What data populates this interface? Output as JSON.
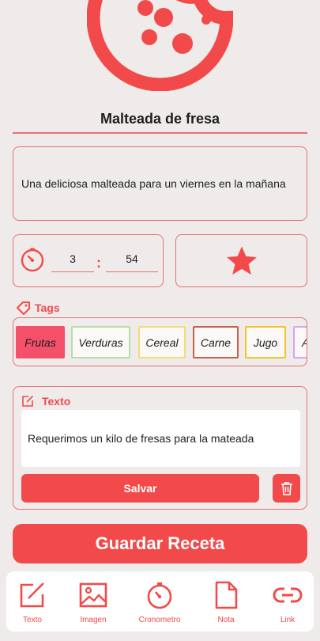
{
  "recipe": {
    "title": "Malteada de fresa",
    "description": "Una deliciosa malteada para un viernes en la mañana"
  },
  "timer": {
    "hours": "3",
    "separator": ":",
    "minutes": "54"
  },
  "favorite": {
    "icon": "star-icon"
  },
  "tags": {
    "label": "Tags",
    "items": [
      {
        "label": "Frutas",
        "selected": true,
        "color": "#f45069"
      },
      {
        "label": "Verduras",
        "selected": false,
        "color": "#b4dfa6"
      },
      {
        "label": "Cereal",
        "selected": false,
        "color": "#f3dc74"
      },
      {
        "label": "Carne",
        "selected": false,
        "color": "#c85e4d"
      },
      {
        "label": "Jugo",
        "selected": false,
        "color": "#f3c42d"
      },
      {
        "label": "A",
        "selected": false,
        "color": "#d6a5ee"
      }
    ]
  },
  "note": {
    "header": "Texto",
    "content": "Requerimos un kilo de fresas para la mateada",
    "save_label": "Salvar"
  },
  "save_recipe_label": "Guardar Receta",
  "bottom_nav": [
    {
      "label": "Texto",
      "icon": "edit-icon"
    },
    {
      "label": "Imagen",
      "icon": "image-icon"
    },
    {
      "label": "Cronometro",
      "icon": "stopwatch-icon"
    },
    {
      "label": "Nota",
      "icon": "note-icon"
    },
    {
      "label": "Link",
      "icon": "link-icon"
    }
  ],
  "colors": {
    "accent": "#f24a4a",
    "border": "#e57070",
    "background": "#efebea"
  }
}
